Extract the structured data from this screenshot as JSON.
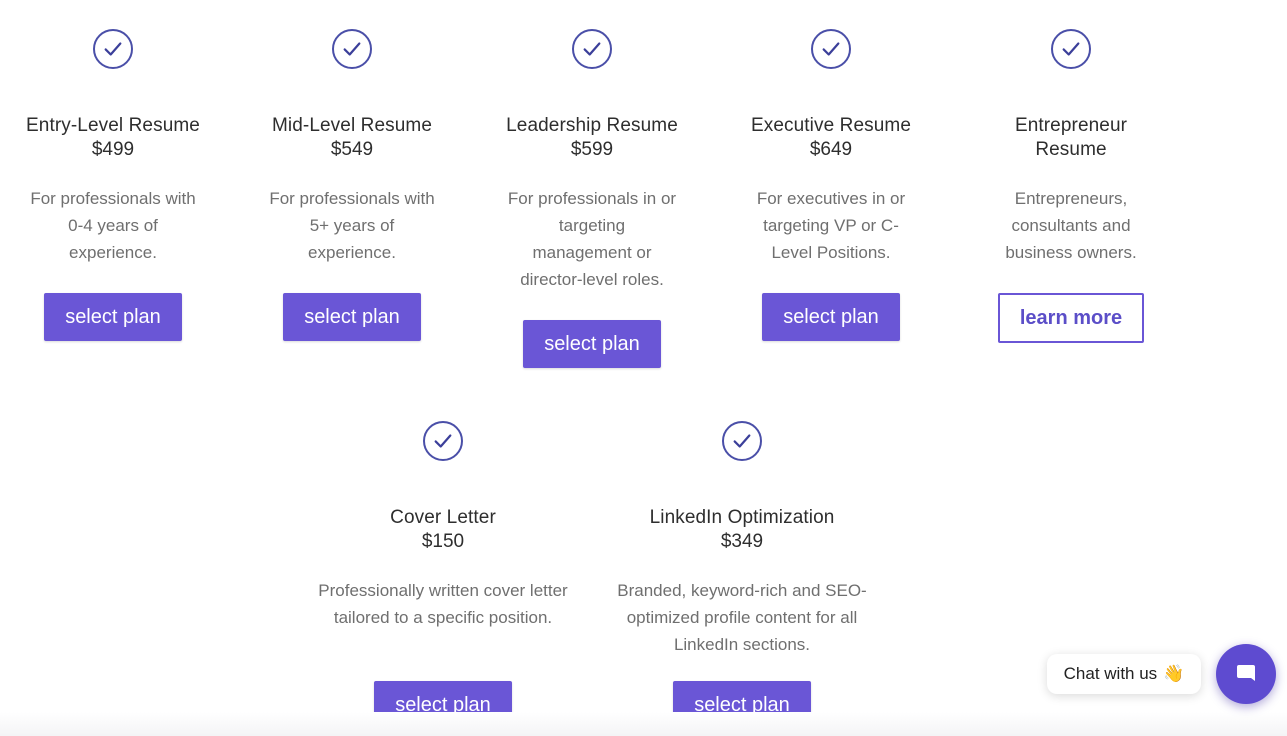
{
  "plans_row1": [
    {
      "title": "Entry-Level Resume",
      "price": "$499",
      "desc_lines": [
        "For professionals with",
        "0-4 years of",
        "experience."
      ],
      "button": "select plan"
    },
    {
      "title": "Mid-Level Resume",
      "price": "$549",
      "desc_lines": [
        "For professionals with",
        "5+ years of",
        "experience."
      ],
      "button": "select plan"
    },
    {
      "title": "Leadership Resume",
      "price": "$599",
      "desc_lines": [
        "For professionals in or",
        "targeting",
        "management or",
        "director-level roles."
      ],
      "button": "select plan"
    },
    {
      "title": "Executive Resume",
      "price": "$649",
      "desc_lines": [
        "For executives in or",
        "targeting VP or C-",
        "Level Positions."
      ],
      "button": "select plan"
    },
    {
      "title_lines": [
        "Entrepreneur",
        "Resume"
      ],
      "desc_lines": [
        "Entrepreneurs,",
        "consultants and",
        "business owners."
      ],
      "button": "learn more"
    }
  ],
  "plans_row2": [
    {
      "title": "Cover Letter",
      "price": "$150",
      "desc_lines": [
        "Professionally written cover letter",
        "tailored to a specific position."
      ],
      "button": "select plan"
    },
    {
      "title": "LinkedIn Optimization",
      "price": "$349",
      "desc_lines": [
        "Branded, keyword-rich and SEO-",
        "optimized profile content for all",
        "LinkedIn sections."
      ],
      "button": "select plan"
    }
  ],
  "chat": {
    "label": "Chat with us",
    "emoji": "👋"
  },
  "icons": {
    "plan_check": "check-circle-icon",
    "chat": "chat-bubble-icon"
  },
  "colors": {
    "accent": "#6a56d6",
    "check": "#4a4fa8",
    "text": "#2e2e2e",
    "muted": "#6f6f6f"
  }
}
